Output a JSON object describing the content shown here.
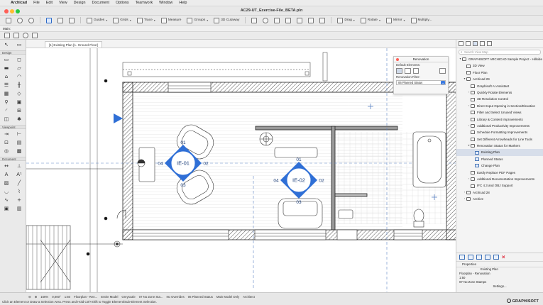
{
  "menubar": {
    "app": "Archicad",
    "items": [
      "File",
      "Edit",
      "View",
      "Design",
      "Document",
      "Options",
      "Teamwork",
      "Window",
      "Help"
    ]
  },
  "window": {
    "title": "AC29-UT_Exercise-File_BETA.pln"
  },
  "toolbar": {
    "guides": "Guides",
    "grids": "Grids",
    "trace": "Trace",
    "measure": "Measure",
    "groups": "Groups",
    "cutaway": "3D Cutaway",
    "drag": "Drag",
    "rotate": "Rotate",
    "mirror": "Mirror",
    "multiply": "Multiply..."
  },
  "inforow": {
    "label": "Main:"
  },
  "toolbox": {
    "sections": [
      {
        "title": "Design",
        "tools": [
          "wall",
          "column",
          "beam",
          "slab",
          "roof",
          "shell",
          "stair",
          "railing",
          "curtain-wall",
          "morph",
          "object",
          "zone",
          "door",
          "window",
          "skylight",
          "lamp"
        ]
      },
      {
        "title": "Viewpoint",
        "tools": [
          "section",
          "elevation",
          "interior-elevation",
          "worksheet",
          "detail",
          "3d-document"
        ]
      },
      {
        "title": "Document",
        "tools": [
          "dimension",
          "level-dimension",
          "text",
          "label",
          "fill",
          "line",
          "arc",
          "polyline",
          "spline",
          "hotspot",
          "figure",
          "drawing"
        ]
      }
    ]
  },
  "tabs": [
    {
      "label": "[1] Existing Plan [1. Ground Floor]"
    }
  ],
  "markers": [
    {
      "id": "IE-01",
      "n": "01",
      "e": "02",
      "s": "03",
      "w": "04"
    },
    {
      "id": "IE-02",
      "n": "01",
      "e": "02",
      "s": "03",
      "w": "04"
    }
  ],
  "renovation_palette": {
    "title": "Renovation",
    "default_elements_label": "Default Elements:",
    "filter_label": "Renovation Filter:",
    "filter_value": "06 Planned Status"
  },
  "navigator": {
    "search_placeholder": "Search View Map",
    "tree": [
      {
        "label": "GRAPHISOFT ARCHICAD Sample Project - Hillside",
        "level": 0,
        "tri": "▾",
        "icon": "folder"
      },
      {
        "label": "3D View",
        "level": 1,
        "tri": "",
        "icon": "view"
      },
      {
        "label": "Floor Plan",
        "level": 1,
        "tri": "",
        "icon": "view"
      },
      {
        "label": "Archicad 29",
        "level": 1,
        "tri": "▾",
        "icon": "folder"
      },
      {
        "label": "Graphisoft AI Assistant",
        "level": 2,
        "tri": "",
        "icon": "view"
      },
      {
        "label": "Quickly Rotate Elements",
        "level": 2,
        "tri": "›",
        "icon": "folder"
      },
      {
        "label": "3D Resolution Control",
        "level": 2,
        "tri": "",
        "icon": "view"
      },
      {
        "label": "Direct Input Opening in Section/Elevation",
        "level": 2,
        "tri": "›",
        "icon": "folder"
      },
      {
        "label": "Filter and Select Unused Views",
        "level": 2,
        "tri": "",
        "icon": "view"
      },
      {
        "label": "Library & Content Improvements",
        "level": 2,
        "tri": "",
        "icon": "view"
      },
      {
        "label": "Additional Productivity Improvements",
        "level": 2,
        "tri": "›",
        "icon": "folder"
      },
      {
        "label": "Schedule Formatting Improvements",
        "level": 2,
        "tri": "",
        "icon": "view"
      },
      {
        "label": "Set Different Arrowheads for Line Tools",
        "level": 2,
        "tri": "",
        "icon": "view"
      },
      {
        "label": "Renovation Status for Markers",
        "level": 2,
        "tri": "▾",
        "icon": "folder"
      },
      {
        "label": "Existing Plan",
        "level": 3,
        "tri": "",
        "icon": "plan",
        "selected": true
      },
      {
        "label": "Planned Status",
        "level": 3,
        "tri": "",
        "icon": "plan"
      },
      {
        "label": "Change Plan",
        "level": 3,
        "tri": "",
        "icon": "plan"
      },
      {
        "label": "Easily Replace PDF Pages",
        "level": 2,
        "tri": "",
        "icon": "view"
      },
      {
        "label": "Additional Documentation Improvements",
        "level": 2,
        "tri": "›",
        "icon": "folder"
      },
      {
        "label": "IFC 4.3 and OBJ Support",
        "level": 2,
        "tri": "",
        "icon": "view"
      },
      {
        "label": "Archicad 28",
        "level": 1,
        "tri": "›",
        "icon": "folder"
      },
      {
        "label": "Archive",
        "level": 1,
        "tri": "›",
        "icon": "folder"
      }
    ]
  },
  "properties": {
    "title": "Properties",
    "rows": [
      "Existing Plan",
      "Floorplan - Renovation",
      "1:50",
      "07 No Zone Stamps"
    ],
    "settings_button": "Settings..."
  },
  "statusbar": {
    "message": "Click an Element or Draw a Selection Area. Press and Hold Ctrl+Shift to Toggle Element/Sub-Element Selection.",
    "zoom": "166%",
    "angle": "0,000°",
    "scale": "1:50",
    "layer_combo": "Floorplan - Ren...",
    "model_view": "Entire Model",
    "pen_set": "Greyscale",
    "zone_stamps": "07 No Zone Sta...",
    "overrides": "No Overrides",
    "reno_filter": "06 Planned Status",
    "mvo": "Main Model Only",
    "dimension": "Architect",
    "brand": "GRAPHISOFT"
  }
}
